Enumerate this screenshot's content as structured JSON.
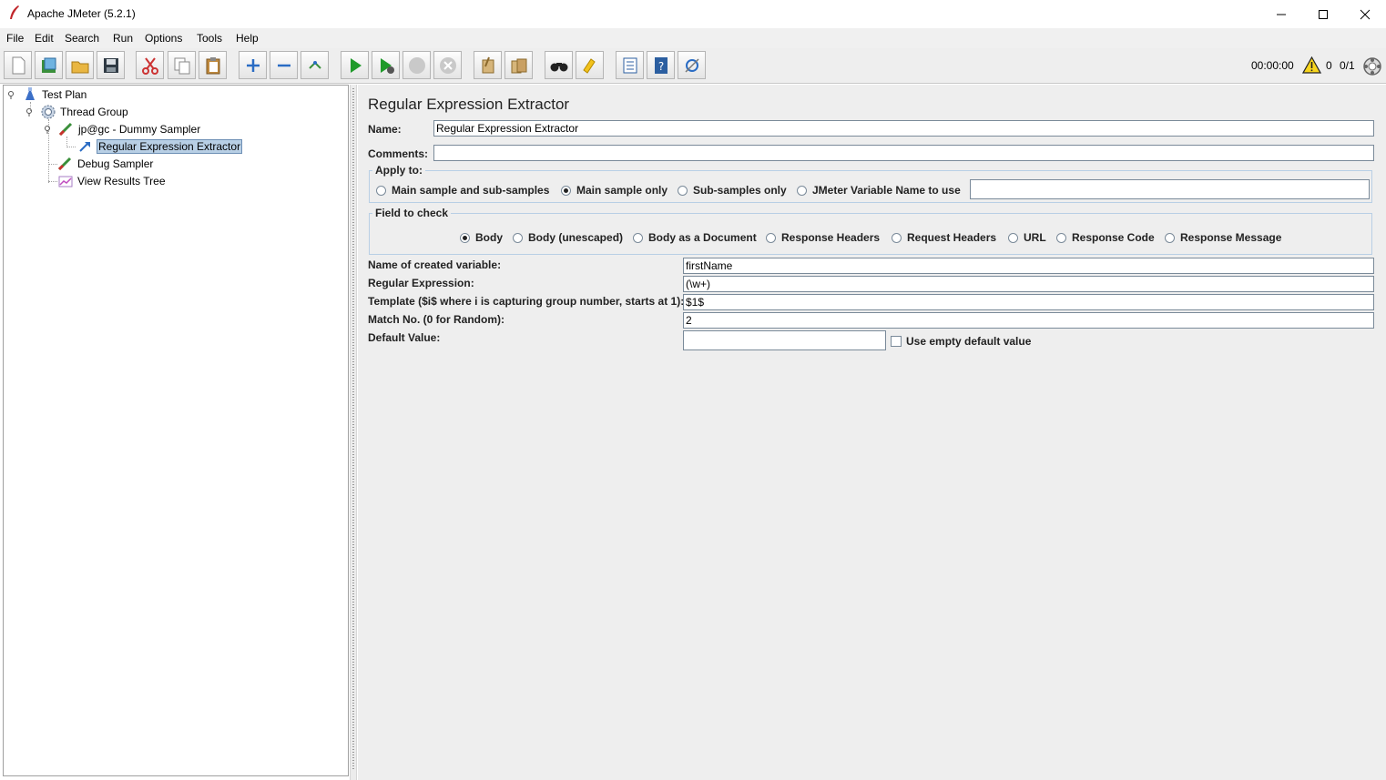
{
  "window": {
    "title": "Apache JMeter (5.2.1)",
    "minimize": "—",
    "maximize": "☐",
    "close": "✕"
  },
  "menu": [
    {
      "label": "File"
    },
    {
      "label": "Edit"
    },
    {
      "label": "Search"
    },
    {
      "label": "Run"
    },
    {
      "label": "Options"
    },
    {
      "label": "Tools"
    },
    {
      "label": "Help"
    }
  ],
  "toolbar": {
    "buttons": [
      "new-icon",
      "templates-icon",
      "open-icon",
      "save-icon",
      "cut-icon",
      "copy-icon",
      "paste-icon",
      "expand-icon",
      "collapse-icon",
      "toggle-icon",
      "start-icon",
      "start-no-pause-icon",
      "stop-icon",
      "shutdown-icon",
      "clear-icon",
      "clear-all-icon",
      "search-icon",
      "reset-search-icon",
      "function-helper-icon",
      "help-icon",
      "remote-icon"
    ]
  },
  "status": {
    "elapsed": "00:00:00",
    "warnings": "0",
    "threads": "0/1"
  },
  "tree": {
    "items": [
      {
        "label": "Test Plan",
        "icon": "test-plan-icon"
      },
      {
        "label": "Thread Group",
        "icon": "thread-group-icon"
      },
      {
        "label": "jp@gc - Dummy Sampler",
        "icon": "sampler-icon"
      },
      {
        "label": "Regular Expression Extractor",
        "icon": "extractor-icon"
      },
      {
        "label": "Debug Sampler",
        "icon": "sampler-icon"
      },
      {
        "label": "View Results Tree",
        "icon": "listener-icon"
      }
    ]
  },
  "panel": {
    "title": "Regular Expression Extractor",
    "name_label": "Name:",
    "name_value": "Regular Expression Extractor",
    "comments_label": "Comments:",
    "comments_value": "",
    "apply_to": {
      "title": "Apply to:",
      "options": [
        "Main sample and sub-samples",
        "Main sample only",
        "Sub-samples only",
        "JMeter Variable Name to use"
      ],
      "selected": "Main sample only",
      "variable_value": ""
    },
    "field_to_check": {
      "title": "Field to check",
      "options": [
        "Body",
        "Body (unescaped)",
        "Body as a Document",
        "Response Headers",
        "Request Headers",
        "URL",
        "Response Code",
        "Response Message"
      ],
      "selected": "Body"
    },
    "rows": [
      {
        "label": "Name of created variable:",
        "value": "firstName"
      },
      {
        "label": "Regular Expression:",
        "value": "(\\w+)"
      },
      {
        "label": "Template ($i$ where i is capturing group number, starts at 1):",
        "value": "$1$"
      },
      {
        "label": "Match No. (0 for Random):",
        "value": "2"
      },
      {
        "label": "Default Value:",
        "value": ""
      }
    ],
    "use_empty_default_label": "Use empty default value"
  }
}
